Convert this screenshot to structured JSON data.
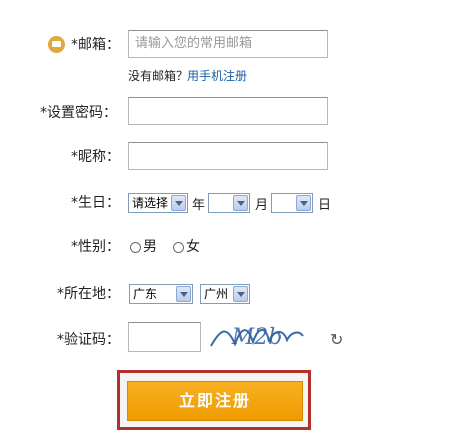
{
  "email": {
    "label": "*邮箱：",
    "placeholder": "请输入您的常用邮箱",
    "no_email_text": "没有邮箱？",
    "phone_link": "用手机注册"
  },
  "password": {
    "label": "*设置密码："
  },
  "nickname": {
    "label": "*昵称："
  },
  "birthday": {
    "label": "*生日：",
    "year_value": "请选择",
    "year_unit": "年",
    "month_value": "",
    "month_unit": "月",
    "day_value": "",
    "day_unit": "日"
  },
  "gender": {
    "label": "*性别：",
    "options": [
      "男",
      "女"
    ]
  },
  "location": {
    "label": "*所在地：",
    "province": "广东",
    "city": "广州"
  },
  "captcha": {
    "label": "*验证码：",
    "image_text": "M2b"
  },
  "submit": {
    "label": "立即注册"
  },
  "colors": {
    "button": "#f0a000",
    "frame": "#b1312a",
    "link": "#1a5fa8"
  }
}
